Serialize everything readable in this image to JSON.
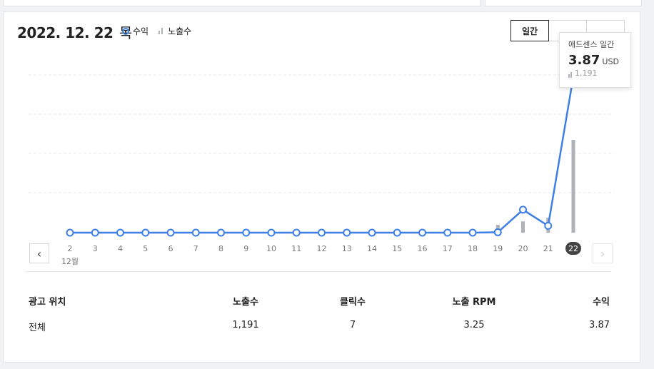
{
  "header": {
    "date": "2022. 12. 22",
    "weekday": "목",
    "legend_revenue": "수익",
    "legend_impressions": "노출수"
  },
  "period_tabs": [
    {
      "label": "일간",
      "active": true
    },
    {
      "label": "",
      "active": false
    },
    {
      "label": "",
      "active": false
    }
  ],
  "tooltip": {
    "title": "애드센스 일간",
    "value": "3.87",
    "unit": "USD",
    "impressions": "1,191"
  },
  "chart_data": {
    "type": "line",
    "x": [
      "2",
      "3",
      "4",
      "5",
      "6",
      "7",
      "8",
      "9",
      "10",
      "11",
      "12",
      "13",
      "14",
      "15",
      "16",
      "17",
      "18",
      "19",
      "20",
      "21",
      "22"
    ],
    "x_sublabel": "12월",
    "selected": "22",
    "series": [
      {
        "name": "수익",
        "type": "line",
        "color": "#3d7fe6",
        "values": [
          0,
          0,
          0,
          0,
          0,
          0,
          0,
          0,
          0,
          0,
          0,
          0,
          0,
          0,
          0,
          0,
          0,
          0.01,
          0.57,
          0.17,
          3.87
        ]
      },
      {
        "name": "노출수",
        "type": "bar",
        "color": "#aeb3b9",
        "values": [
          0,
          0,
          0,
          0,
          0,
          0,
          0,
          0,
          0,
          0,
          0,
          0,
          0,
          0,
          0,
          0,
          0,
          102,
          145,
          191,
          1191
        ]
      }
    ],
    "grid": true
  },
  "nav": {
    "prev_icon": "‹",
    "next_icon": "›"
  },
  "table": {
    "headers": [
      "광고 위치",
      "노출수",
      "클릭수",
      "노출 RPM",
      "수익"
    ],
    "rows": [
      [
        "전체",
        "1,191",
        "7",
        "3.25",
        "3.87"
      ]
    ]
  }
}
